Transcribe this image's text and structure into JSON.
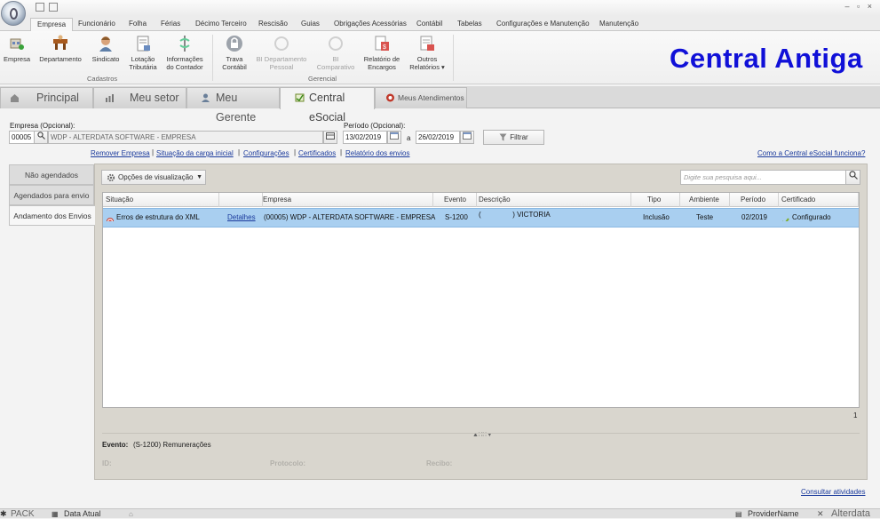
{
  "window": {
    "controls": "– ▫ ×"
  },
  "menu_tabs": [
    {
      "label": "Empresa",
      "active": true
    },
    {
      "label": "Funcionário"
    },
    {
      "label": "Folha"
    },
    {
      "label": "Férias"
    },
    {
      "label": "Décimo Terceiro"
    },
    {
      "label": "Rescisão"
    },
    {
      "label": "Guias"
    },
    {
      "label": "Obrigações Acessórias"
    },
    {
      "label": "Contábil"
    },
    {
      "label": "Tabelas"
    },
    {
      "label": "Configurações e Manutenção"
    },
    {
      "label": "Manutenção"
    }
  ],
  "ribbon": {
    "buttons": [
      {
        "line1": "Empresa",
        "line2": "",
        "enabled": true,
        "icon": "company-icon"
      },
      {
        "line1": "Departamento",
        "line2": "",
        "enabled": true,
        "icon": "department-icon"
      },
      {
        "line1": "Sindicato",
        "line2": "",
        "enabled": true,
        "icon": "union-icon"
      },
      {
        "line1": "Lotação",
        "line2": "Tributária",
        "enabled": true,
        "icon": "tax-allocation-icon"
      },
      {
        "line1": "Informações",
        "line2": "do Contador",
        "enabled": true,
        "icon": "accountant-icon"
      },
      {
        "line1": "Trava",
        "line2": "Contábil",
        "enabled": true,
        "icon": "lock-icon"
      },
      {
        "line1": "BI Departamento",
        "line2": "Pessoal",
        "enabled": false,
        "icon": "bi-department-icon"
      },
      {
        "line1": "BI",
        "line2": "Comparativo",
        "enabled": false,
        "icon": "bi-compare-icon"
      },
      {
        "line1": "Relatório de",
        "line2": "Encargos",
        "enabled": true,
        "icon": "report-icon"
      },
      {
        "line1": "Outros",
        "line2": "Relatórios ▾",
        "enabled": true,
        "icon": "other-reports-icon"
      }
    ],
    "group_cadastros": "Cadastros",
    "group_gerencial": "Gerencial",
    "brand_title": "Central Antiga"
  },
  "nav_tabs": [
    {
      "label": "Principal",
      "icon": "home-icon"
    },
    {
      "label": "Meu setor",
      "icon": "chart-icon"
    },
    {
      "label": "Meu Gerente",
      "icon": "user-icon"
    },
    {
      "label": "Central eSocial",
      "icon": "esocial-icon",
      "active": true
    },
    {
      "label": "Meus Atendimentos",
      "icon": "support-icon"
    }
  ],
  "filters": {
    "empresa_label": "Empresa (Opcional):",
    "empresa_code": "00005",
    "empresa_name": "WDP - ALTERDATA SOFTWARE - EMPRESA",
    "periodo_label": "Período (Opcional):",
    "date_from": "13/02/2019",
    "date_sep": "a",
    "date_to": "26/02/2019",
    "filter_button": "Filtrar"
  },
  "links": {
    "remover": "Remover Empresa",
    "situacao": "Situação da carga inicial",
    "configuracoes": "Configurações",
    "certificados": "Certificados",
    "relatorio": "Relatório dos envios",
    "como": "Como a Central eSocial funciona?",
    "consultar": "Consultar atividades"
  },
  "side_tabs": [
    {
      "label": "Não agendados"
    },
    {
      "label": "Agendados para envio"
    },
    {
      "label": "Andamento dos Envios",
      "active": true
    }
  ],
  "toolbar": {
    "view_options": "Opções de visualização",
    "search_placeholder": "Digite sua pesquisa aqui..."
  },
  "grid": {
    "columns": [
      "Situação",
      "",
      "Empresa",
      "Evento",
      "Descrição",
      "Tipo",
      "Ambiente",
      "Período",
      "Certificado"
    ],
    "rows": [
      {
        "situacao": "Erros de estrutura do XML",
        "detalhes": "Detalhes",
        "empresa": "(00005) WDP - ALTERDATA SOFTWARE - EMPRESA",
        "evento": "S-1200",
        "descricao": "(                ) VICTORIA",
        "tipo": "Inclusão",
        "ambiente": "Teste",
        "periodo": "02/2019",
        "certificado": "Configurado"
      }
    ],
    "count": "1"
  },
  "detail": {
    "evento_label": "Evento:",
    "evento_value": "(S-1200) Remunerações",
    "id_label": "ID:",
    "protocolo_label": "Protocolo:",
    "recibo_label": "Recibo:"
  },
  "statusbar": {
    "pack": "PACK",
    "data_atual": "Data Atual",
    "provider": "ProviderName",
    "brand": "Alterdata"
  },
  "colors": {
    "brand_blue": "#1010d8",
    "selected_row": "#a9cff0",
    "link": "#1a3a9c",
    "panel_bg": "#d9d6ce"
  }
}
